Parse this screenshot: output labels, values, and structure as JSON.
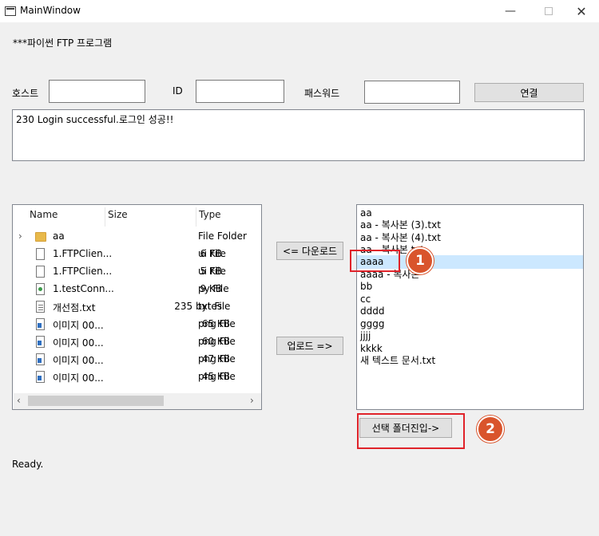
{
  "window": {
    "title": "MainWindow",
    "minimize_glyph": "—",
    "close_glyph": "✕"
  },
  "header": {
    "label": "***파이썬 FTP 프로그램"
  },
  "connection": {
    "host_label": "호스트",
    "host_value": "",
    "id_label": "ID",
    "id_value": "",
    "password_label": "패스워드",
    "password_value": "",
    "connect_button": "연결"
  },
  "log": {
    "text": "230 Login successful.로그인 성공!!"
  },
  "local_tree": {
    "columns": [
      "Name",
      "Size",
      "Type"
    ],
    "rows": [
      {
        "name": "aa",
        "size": "",
        "type": "File Folder",
        "icon": "folder-icon"
      },
      {
        "name": "1.FTPClien...",
        "size": "6 KB",
        "type": "ui File",
        "icon": "file-icon"
      },
      {
        "name": "1.FTPClien...",
        "size": "5 KB",
        "type": "ui File",
        "icon": "file-icon"
      },
      {
        "name": "1.testConn...",
        "size": "9 KB",
        "type": "py File",
        "icon": "python-file-icon"
      },
      {
        "name": "개선점.txt",
        "size": "235 bytes",
        "type": "txt File",
        "icon": "text-file-icon"
      },
      {
        "name": "이미지 00...",
        "size": "65 KB",
        "type": "png File",
        "icon": "image-file-icon"
      },
      {
        "name": "이미지 00...",
        "size": "60 KB",
        "type": "png File",
        "icon": "image-file-icon"
      },
      {
        "name": "이미지 00...",
        "size": "47 KB",
        "type": "png File",
        "icon": "image-file-icon"
      },
      {
        "name": "이미지 00...",
        "size": "45 KB",
        "type": "png File",
        "icon": "image-file-icon"
      }
    ],
    "expand_glyph": "›",
    "scroll_left_glyph": "‹",
    "scroll_right_glyph": "›"
  },
  "transfer": {
    "download_button": "<= 다운로드",
    "upload_button": "업로드 =>"
  },
  "remote_list": {
    "items": [
      "aa",
      "aa - 복사본 (3).txt",
      "aa - 복사본 (4).txt",
      "aa - 복사본.txt",
      "aaaa",
      "aaaa - 복사본",
      "bb",
      "cc",
      "dddd",
      "gggg",
      "jjjj",
      "kkkk",
      "새 텍스트 문서.txt"
    ],
    "selected_index": 4,
    "enter_folder_button": "선택 폴더진입->"
  },
  "annotations": {
    "badge_1": "1",
    "badge_2": "2",
    "color": "#e0232a"
  },
  "status": {
    "text": "Ready."
  }
}
